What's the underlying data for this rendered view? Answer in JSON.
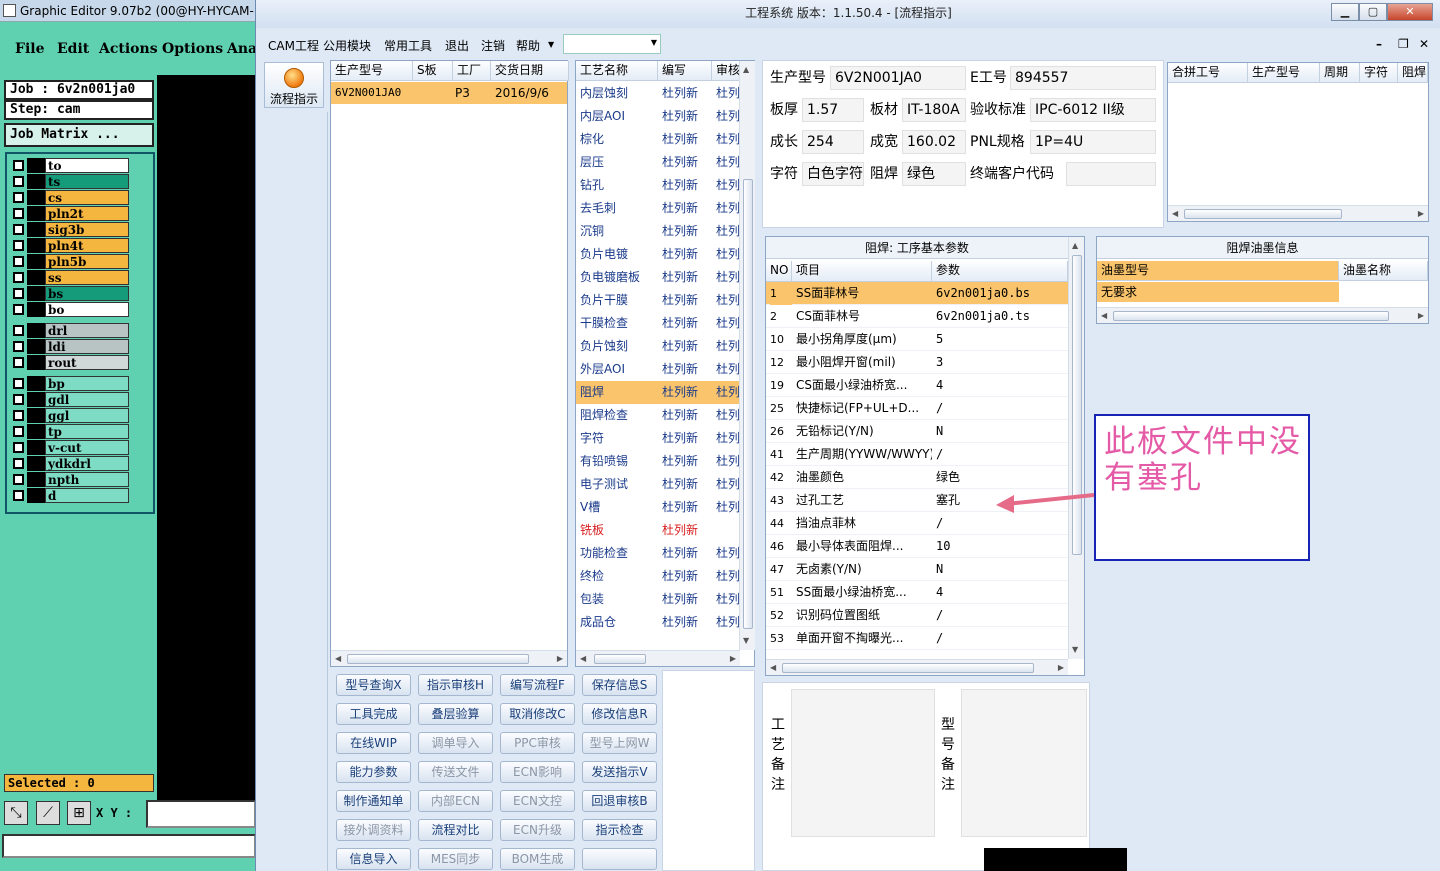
{
  "gfx": {
    "title": "Graphic Editor 9.07b2 (00@HY-HYCAM-",
    "menu": [
      "File",
      "Edit",
      "Actions",
      "Options",
      "Ana"
    ],
    "job": "Job : 6v2n001ja0",
    "step": "Step: cam",
    "job_matrix": "Job Matrix ...",
    "layers": [
      {
        "name": "to",
        "color": "#ffffff"
      },
      {
        "name": "ts",
        "color": "#159a7a"
      },
      {
        "name": "cs",
        "color": "#f5b640"
      },
      {
        "name": "pln2t",
        "color": "#f5b640"
      },
      {
        "name": "sig3b",
        "color": "#f5b640"
      },
      {
        "name": "pln4t",
        "color": "#f5b640"
      },
      {
        "name": "pln5b",
        "color": "#f5b640"
      },
      {
        "name": "ss",
        "color": "#f5b640"
      },
      {
        "name": "bs",
        "color": "#159a7a"
      },
      {
        "name": "bo",
        "color": "#ffffff"
      },
      {
        "name": "drl",
        "color": "#b8c4c4"
      },
      {
        "name": "ldi",
        "color": "#b8c4c4"
      },
      {
        "name": "rout",
        "color": "#d0d8d8"
      },
      {
        "name": "bp",
        "color": "#7fdcc4"
      },
      {
        "name": "gdl",
        "color": "#7fdcc4"
      },
      {
        "name": "ggl",
        "color": "#7fdcc4"
      },
      {
        "name": "tp",
        "color": "#7fdcc4"
      },
      {
        "name": "v-cut",
        "color": "#7fdcc4"
      },
      {
        "name": "ydkdrl",
        "color": "#7fdcc4"
      },
      {
        "name": "npth",
        "color": "#7fdcc4"
      },
      {
        "name": "d",
        "color": "#7fdcc4"
      }
    ],
    "selected": "Selected : 0",
    "xy_label": "X Y :"
  },
  "win": {
    "title": "工程系统   版本：1.1.50.4 - [流程指示]",
    "menu": [
      "CAM工程",
      "公用模块",
      "常用工具",
      "退出",
      "注销",
      "帮助"
    ],
    "nav_label": "流程指示",
    "orders": {
      "headers": [
        "生产型号",
        "S板",
        "工厂",
        "交货日期"
      ],
      "rows": [
        [
          "6V2N001JA0",
          "",
          "P3",
          "2016/9/6"
        ]
      ]
    },
    "processes": {
      "headers": [
        "工艺名称",
        "编写",
        "审核"
      ],
      "rows": [
        {
          "name": "内层蚀刻",
          "writer": "杜列新",
          "reviewer": "杜列"
        },
        {
          "name": "内层AOI",
          "writer": "杜列新",
          "reviewer": "杜列"
        },
        {
          "name": "棕化",
          "writer": "杜列新",
          "reviewer": "杜列"
        },
        {
          "name": "层压",
          "writer": "杜列新",
          "reviewer": "杜列"
        },
        {
          "name": "钻孔",
          "writer": "杜列新",
          "reviewer": "杜列"
        },
        {
          "name": "去毛刺",
          "writer": "杜列新",
          "reviewer": "杜列"
        },
        {
          "name": "沉铜",
          "writer": "杜列新",
          "reviewer": "杜列"
        },
        {
          "name": "负片电镀",
          "writer": "杜列新",
          "reviewer": "杜列"
        },
        {
          "name": "负电镀磨板",
          "writer": "杜列新",
          "reviewer": "杜列"
        },
        {
          "name": "负片干膜",
          "writer": "杜列新",
          "reviewer": "杜列"
        },
        {
          "name": "干膜检查",
          "writer": "杜列新",
          "reviewer": "杜列"
        },
        {
          "name": "负片蚀刻",
          "writer": "杜列新",
          "reviewer": "杜列"
        },
        {
          "name": "外层AOI",
          "writer": "杜列新",
          "reviewer": "杜列"
        },
        {
          "name": "阻焊",
          "writer": "杜列新",
          "reviewer": "杜列"
        },
        {
          "name": "阻焊检查",
          "writer": "杜列新",
          "reviewer": "杜列"
        },
        {
          "name": "字符",
          "writer": "杜列新",
          "reviewer": "杜列"
        },
        {
          "name": "有铅喷锡",
          "writer": "杜列新",
          "reviewer": "杜列"
        },
        {
          "name": "电子测试",
          "writer": "杜列新",
          "reviewer": "杜列"
        },
        {
          "name": "V槽",
          "writer": "杜列新",
          "reviewer": "杜列"
        },
        {
          "name": "铣板",
          "writer": "杜列新",
          "reviewer": ""
        },
        {
          "name": "功能检查",
          "writer": "杜列新",
          "reviewer": "杜列"
        },
        {
          "name": "终检",
          "writer": "杜列新",
          "reviewer": "杜列"
        },
        {
          "name": "包装",
          "writer": "杜列新",
          "reviewer": "杜列"
        },
        {
          "name": "成品仓",
          "writer": "杜列新",
          "reviewer": "杜列"
        }
      ]
    },
    "actions": [
      [
        "型号查询X",
        "指示审核H",
        "编写流程F",
        "保存信息S"
      ],
      [
        "工具完成",
        "叠层验算",
        "取消修改C",
        "修改信息R"
      ],
      [
        "在线WIP",
        "调单导入",
        "PPC审核",
        "型号上网W"
      ],
      [
        "能力参数",
        "传送文件",
        "ECN影响",
        "发送指示V"
      ],
      [
        "制作通知单",
        "内部ECN",
        "ECN文控",
        "回退审核B"
      ],
      [
        "接外调资料",
        "流程对比",
        "ECN升级",
        "指示检查"
      ],
      [
        "信息导入",
        "MES同步",
        "BOM生成",
        ""
      ]
    ],
    "info": {
      "model_label": "生产型号",
      "model": "6V2N001JA0",
      "eng_label": "E工号",
      "eng": "894557",
      "thick_label": "板厚",
      "thick": "1.57",
      "mat_label": "板材",
      "mat": "IT-180A",
      "std_label": "验收标准",
      "std": "IPC-6012 II级",
      "len_label": "成长",
      "len": "254",
      "wid_label": "成宽",
      "wid": "160.02",
      "pnl_label": "PNL规格",
      "pnl": "1P=4U",
      "char_label": "字符",
      "char": "白色字符",
      "mask_label": "阻焊",
      "mask": "绿色",
      "cust_label": "终端客户代码",
      "cust": ""
    },
    "combine": {
      "headers": [
        "合拼工号",
        "生产型号",
        "周期",
        "字符",
        "阻焊"
      ]
    },
    "params": {
      "title": "阻焊: 工序基本参数",
      "headers": [
        "NO",
        "项目",
        "参数"
      ],
      "rows": [
        [
          "1",
          "SS面菲林号",
          "6v2n001ja0.bs"
        ],
        [
          "2",
          "CS面菲林号",
          "6v2n001ja0.ts"
        ],
        [
          "10",
          "最小拐角厚度(μm)",
          "5"
        ],
        [
          "12",
          "最小阻焊开窗(mil)",
          "3"
        ],
        [
          "19",
          "CS面最小绿油桥宽...",
          "4"
        ],
        [
          "25",
          "快捷标记(FP+UL+D...",
          "/"
        ],
        [
          "26",
          "无铅标记(Y/N)",
          "N"
        ],
        [
          "41",
          "生产周期(YYWW/WWYY)",
          "/"
        ],
        [
          "42",
          "油墨颜色",
          "绿色"
        ],
        [
          "43",
          "过孔工艺",
          "塞孔"
        ],
        [
          "44",
          "挡油点菲林",
          "/"
        ],
        [
          "46",
          "最小导体表面阻焊...",
          "10"
        ],
        [
          "47",
          "无卤素(Y/N)",
          "N"
        ],
        [
          "51",
          "SS面最小绿油桥宽...",
          "4"
        ],
        [
          "52",
          "识别码位置图纸",
          "/"
        ],
        [
          "53",
          "单面开窗不掏曝光...",
          "/"
        ]
      ]
    },
    "oil": {
      "title": "阻焊油墨信息",
      "headers": [
        "油墨型号",
        "油墨名称"
      ],
      "rows": [
        [
          "无要求",
          ""
        ]
      ]
    },
    "remarks": {
      "process": "工艺备注",
      "model": "型号备注"
    },
    "annotation": "此板文件中没有塞孔"
  }
}
